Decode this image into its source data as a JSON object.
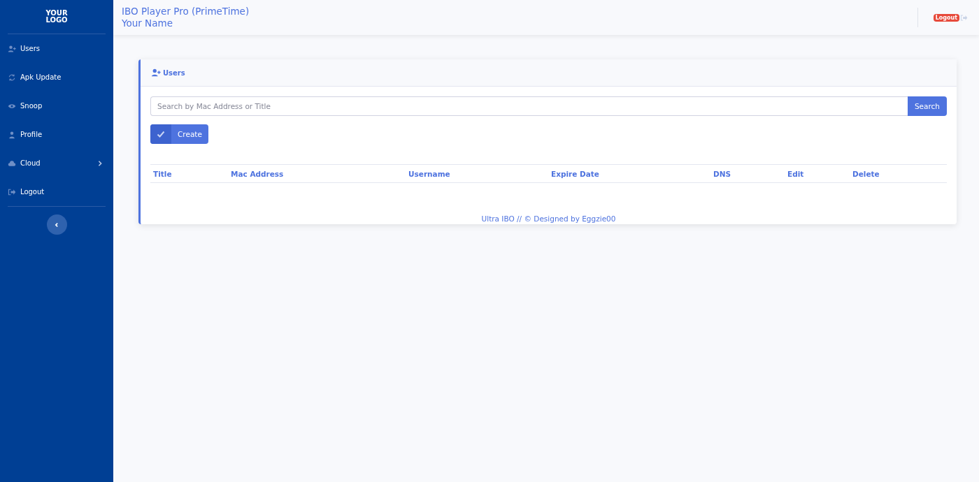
{
  "sidebar": {
    "logo": [
      "YOUR",
      "LOGO"
    ],
    "items": [
      {
        "label": "Users",
        "has_submenu": false
      },
      {
        "label": "Apk Update",
        "has_submenu": false
      },
      {
        "label": "Snoop",
        "has_submenu": false
      },
      {
        "label": "Profile",
        "has_submenu": false
      },
      {
        "label": "Cloud",
        "has_submenu": true
      },
      {
        "label": "Logout",
        "has_submenu": false
      }
    ]
  },
  "header": {
    "title": "IBO Player Pro (PrimeTime)",
    "subtitle": "Your Name",
    "logout_badge": "Logout"
  },
  "card": {
    "title": "Users",
    "search": {
      "placeholder": "Search by Mac Address or Title",
      "button": "Search"
    },
    "create_button": "Create",
    "table": {
      "columns": [
        "Title",
        "Mac Address",
        "Username",
        "Expire Date",
        "DNS",
        "Edit",
        "Delete"
      ]
    }
  },
  "footer": "Ultra IBO // © Designed by Eggzie00"
}
